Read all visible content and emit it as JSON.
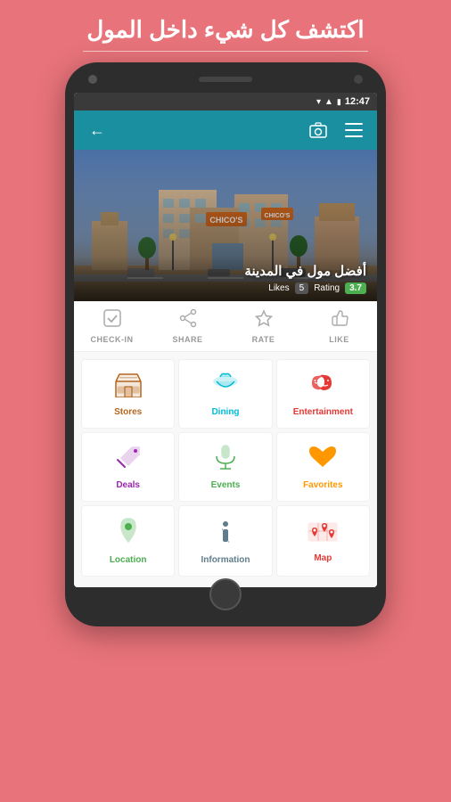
{
  "page": {
    "background_color": "#e8737a",
    "top_heading": "اكتشف كل شيء داخل المول"
  },
  "status_bar": {
    "time": "12:47",
    "wifi": "▼",
    "signal": "▲",
    "battery": "🔋"
  },
  "header": {
    "back_icon": "←",
    "camera_icon": "📷",
    "menu_icon": "≡"
  },
  "hero": {
    "title": "أفضل مول في المدينة",
    "rating_value": "3.7",
    "rating_label": "Rating",
    "likes_value": "5",
    "likes_label": "Likes"
  },
  "actions": [
    {
      "id": "checkin",
      "icon": "✓",
      "label": "CHECK-IN"
    },
    {
      "id": "share",
      "icon": "⇧",
      "label": "SHARE"
    },
    {
      "id": "rate",
      "icon": "★",
      "label": "RATE"
    },
    {
      "id": "like",
      "icon": "👍",
      "label": "LIKE"
    }
  ],
  "grid": [
    [
      {
        "id": "stores",
        "icon": "🏪",
        "label": "Stores",
        "color_class": "stores-color"
      },
      {
        "id": "dining",
        "icon": "🍽",
        "label": "Dining",
        "color_class": "dining-color"
      },
      {
        "id": "entertainment",
        "icon": "🎭",
        "label": "Entertainment",
        "color_class": "entertainment-color"
      }
    ],
    [
      {
        "id": "deals",
        "icon": "🏷",
        "label": "Deals",
        "color_class": "deals-color"
      },
      {
        "id": "events",
        "icon": "🎤",
        "label": "Events",
        "color_class": "events-color"
      },
      {
        "id": "favorites",
        "icon": "❤",
        "label": "Favorites",
        "color_class": "favorites-color"
      }
    ],
    [
      {
        "id": "location",
        "icon": "📍",
        "label": "Location",
        "color_class": "location-color"
      },
      {
        "id": "information",
        "icon": "ℹ",
        "label": "Information",
        "color_class": "info-color"
      },
      {
        "id": "map",
        "icon": "🗺",
        "label": "Map",
        "color_class": "map-color"
      }
    ]
  ]
}
